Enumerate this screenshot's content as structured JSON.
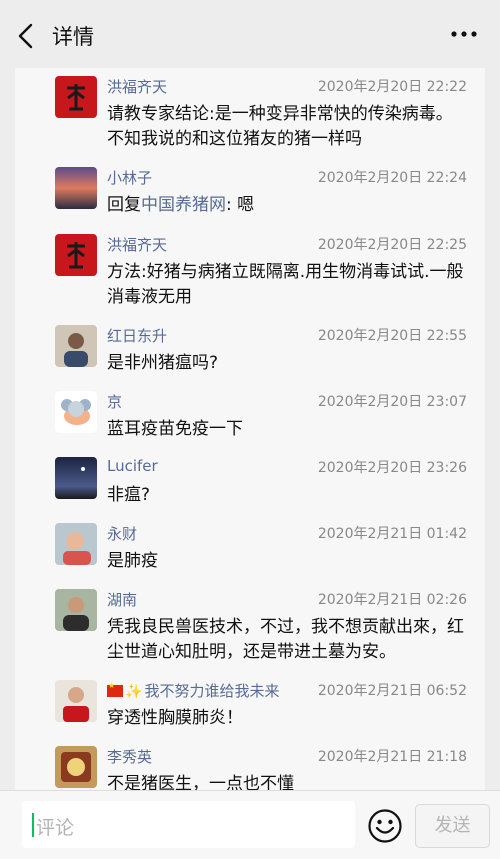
{
  "header": {
    "title": "详情"
  },
  "comments": [
    {
      "name": "洪福齐天",
      "time": "2020年2月20日 22:22",
      "text": "请教专家结论:是一种变异非常快的传染病毒。不知我说的和这位猪友的猪一样吗"
    },
    {
      "name": "小林子",
      "time": "2020年2月20日 22:24",
      "reply_prefix": "回复",
      "reply_to": "中国养猪网",
      "text": ": 嗯"
    },
    {
      "name": "洪福齐天",
      "time": "2020年2月20日 22:25",
      "text": "方法:好猪与病猪立既隔离.用生物消毒试试.一般消毒液无用"
    },
    {
      "name": "红日东升",
      "time": "2020年2月20日 22:55",
      "text": "是非州猪瘟吗?"
    },
    {
      "name": "京",
      "time": "2020年2月20日 23:07",
      "text": "蓝耳疫苗免疫一下"
    },
    {
      "name": "Lucifer",
      "time": "2020年2月20日 23:26",
      "text": "非瘟?"
    },
    {
      "name": "永财",
      "time": "2020年2月21日 01:42",
      "text": "是肺疫"
    },
    {
      "name": "湖南",
      "time": "2020年2月21日 02:26",
      "text": "凭我良民兽医技术，不过，我不想贡献出來，红尘世道心知肚明，还是带进土墓为安。"
    },
    {
      "name": "我不努力谁给我未来",
      "time": "2020年2月21日 06:52",
      "text": "穿透性胸膜肺炎！"
    },
    {
      "name": "李秀英",
      "time": "2020年2月21日 21:18",
      "text": "不是猪医生，一点也不懂"
    }
  ],
  "input": {
    "placeholder": "评论"
  },
  "send_label": "发送",
  "colors": {
    "name": "#576b95",
    "accent": "#07c160",
    "background": "#ededed"
  },
  "icons": {
    "back": "chevron-left-icon",
    "more": "more-dots-icon",
    "emoji": "smiley-face-icon"
  }
}
